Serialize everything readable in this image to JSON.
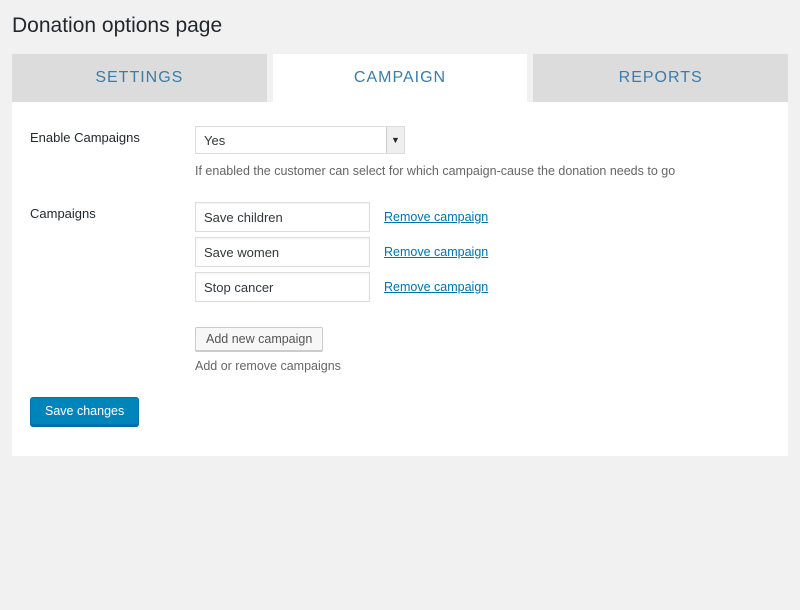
{
  "pageTitle": "Donation options page",
  "tabs": {
    "settings": "SETTINGS",
    "campaign": "CAMPAIGN",
    "reports": "REPORTS"
  },
  "enableCampaigns": {
    "label": "Enable Campaigns",
    "selected": "Yes",
    "helper": "If enabled the customer can select for which campaign-cause the donation needs to go"
  },
  "campaignsSection": {
    "label": "Campaigns",
    "items": [
      {
        "name": "Save children"
      },
      {
        "name": "Save women"
      },
      {
        "name": "Stop cancer"
      }
    ],
    "removeLabel": "Remove campaign",
    "addLabel": "Add new campaign",
    "helper": "Add or remove campaigns"
  },
  "saveLabel": "Save changes"
}
